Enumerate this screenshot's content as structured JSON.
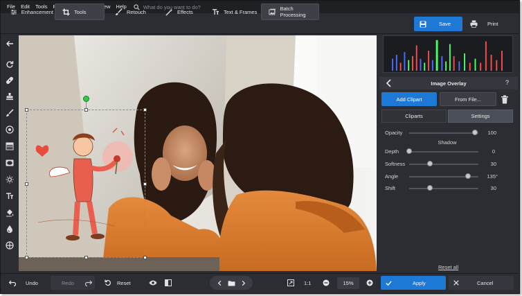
{
  "menu": {
    "items": [
      "File",
      "Edit",
      "Tools",
      "Retouch",
      "Effects",
      "View",
      "Help"
    ],
    "search_placeholder": "What do you want to do?"
  },
  "toolbar": {
    "tabs": [
      {
        "label": "Enhancement",
        "icon": "sliders-icon"
      },
      {
        "label": "Tools",
        "icon": "crop-icon",
        "active": true
      },
      {
        "label": "Retouch",
        "icon": "brush-icon"
      },
      {
        "label": "Effects",
        "icon": "magic-wand-icon"
      },
      {
        "label": "Text & Frames",
        "icon": "text-icon"
      },
      {
        "label": "Batch Processing",
        "icon": "images-icon"
      }
    ],
    "save_label": "Save",
    "print_label": "Print"
  },
  "left_tools": [
    "back-arrow-icon",
    "rotate-icon",
    "bandage-icon",
    "stamp-icon",
    "brush-icon",
    "radial-icon",
    "gradient-icon",
    "vignette-icon",
    "sun-icon",
    "text-icon",
    "fill-icon",
    "blur-icon",
    "overlay-icon"
  ],
  "panel": {
    "title": "Image Overlay",
    "help": "?",
    "add_clipart_label": "Add Clipart",
    "from_file_label": "From File...",
    "tabs": [
      "Cliparts",
      "Settings"
    ],
    "active_tab": "Settings",
    "opacity": {
      "label": "Opacity",
      "value": "100",
      "fraction": 0.95
    },
    "shadow_header": "Shadow",
    "depth": {
      "label": "Depth",
      "value": "0",
      "fraction": 0.0
    },
    "softness": {
      "label": "Softness",
      "value": "30",
      "fraction": 0.3
    },
    "angle": {
      "label": "Angle",
      "value": "135°",
      "fraction": 0.85
    },
    "shift": {
      "label": "Shift",
      "value": "30",
      "fraction": 0.3
    },
    "reset_all_label": "Reset all"
  },
  "bottom": {
    "undo_label": "Undo",
    "redo_label": "Redo",
    "reset_label": "Reset",
    "zoom_fit_label": "1:1",
    "zoom_value": "15%",
    "apply_label": "Apply",
    "cancel_label": "Cancel"
  },
  "colors": {
    "accent": "#1e78d6",
    "window_bg": "#2b2d32",
    "menubar_bg": "#1f2024"
  }
}
